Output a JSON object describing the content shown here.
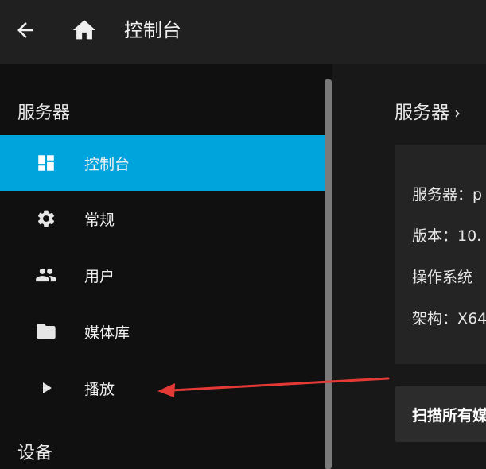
{
  "header": {
    "title": "控制台",
    "back_icon": "back-arrow-icon",
    "home_icon": "home-icon"
  },
  "sidebar": {
    "section_server": "服务器",
    "section_devices": "设备",
    "items": [
      {
        "label": "控制台",
        "icon": "dashboard-icon",
        "active": true
      },
      {
        "label": "常规",
        "icon": "gear-icon",
        "active": false
      },
      {
        "label": "用户",
        "icon": "people-icon",
        "active": false
      },
      {
        "label": "媒体库",
        "icon": "folder-icon",
        "active": false
      },
      {
        "label": "播放",
        "icon": "play-icon",
        "active": false
      }
    ],
    "accent_color": "#00a4dc"
  },
  "main": {
    "heading": "服务器",
    "heading_chevron": "›",
    "info": {
      "server": "服务器：p",
      "version": "版本：10.",
      "os": "操作系统",
      "arch": "架构：X64"
    },
    "scan_button": "扫描所有媒"
  },
  "annotation": {
    "arrow_color": "#e53935"
  }
}
